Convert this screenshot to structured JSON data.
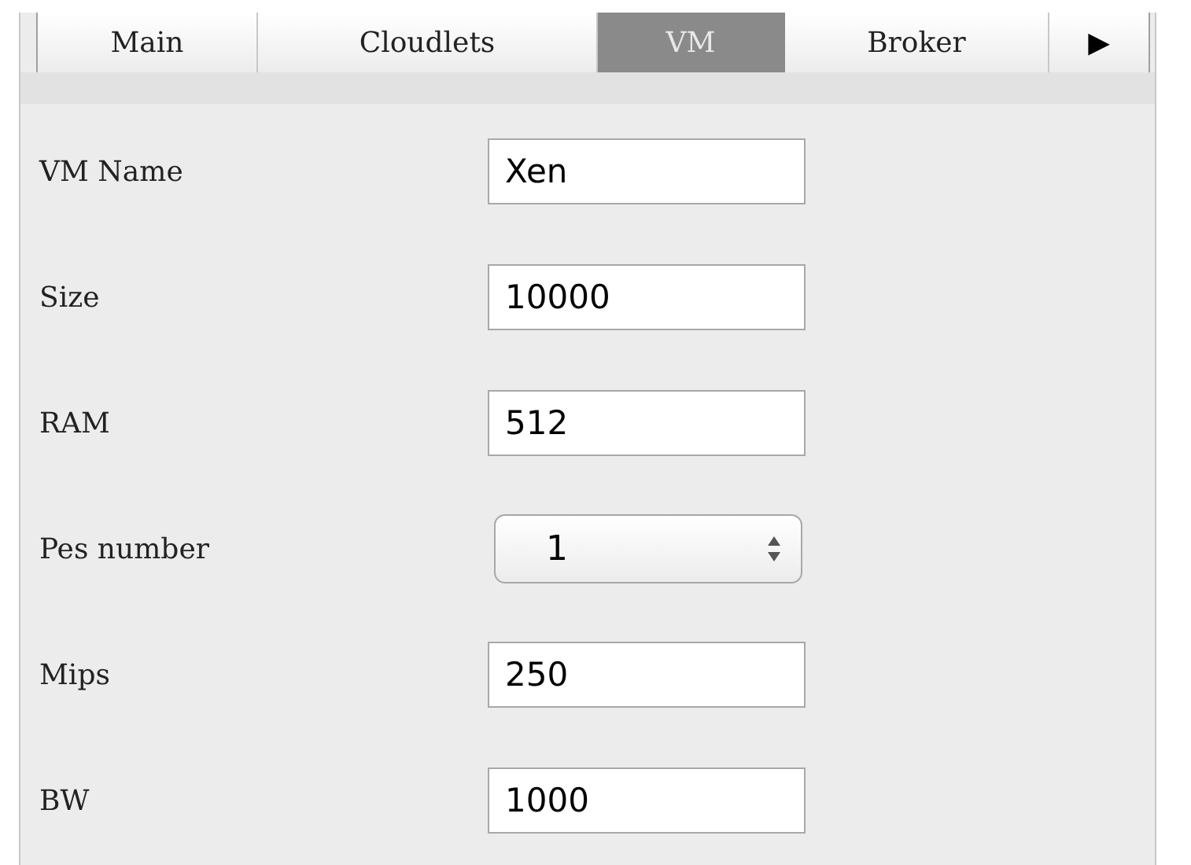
{
  "tabs": [
    {
      "label": "Main",
      "selected": false
    },
    {
      "label": "Cloudlets",
      "selected": false
    },
    {
      "label": "VM",
      "selected": true
    },
    {
      "label": "Broker",
      "selected": false
    }
  ],
  "tab_scroll_button": "▶",
  "fields": [
    {
      "label": "VM Name",
      "kind": "text",
      "value": "Xen"
    },
    {
      "label": "Size",
      "kind": "text",
      "value": "10000"
    },
    {
      "label": "RAM",
      "kind": "text",
      "value": "512"
    },
    {
      "label": "Pes number",
      "kind": "stepper",
      "value": "1"
    },
    {
      "label": "Mips",
      "kind": "text",
      "value": "250"
    },
    {
      "label": "BW",
      "kind": "text",
      "value": "1000"
    }
  ]
}
